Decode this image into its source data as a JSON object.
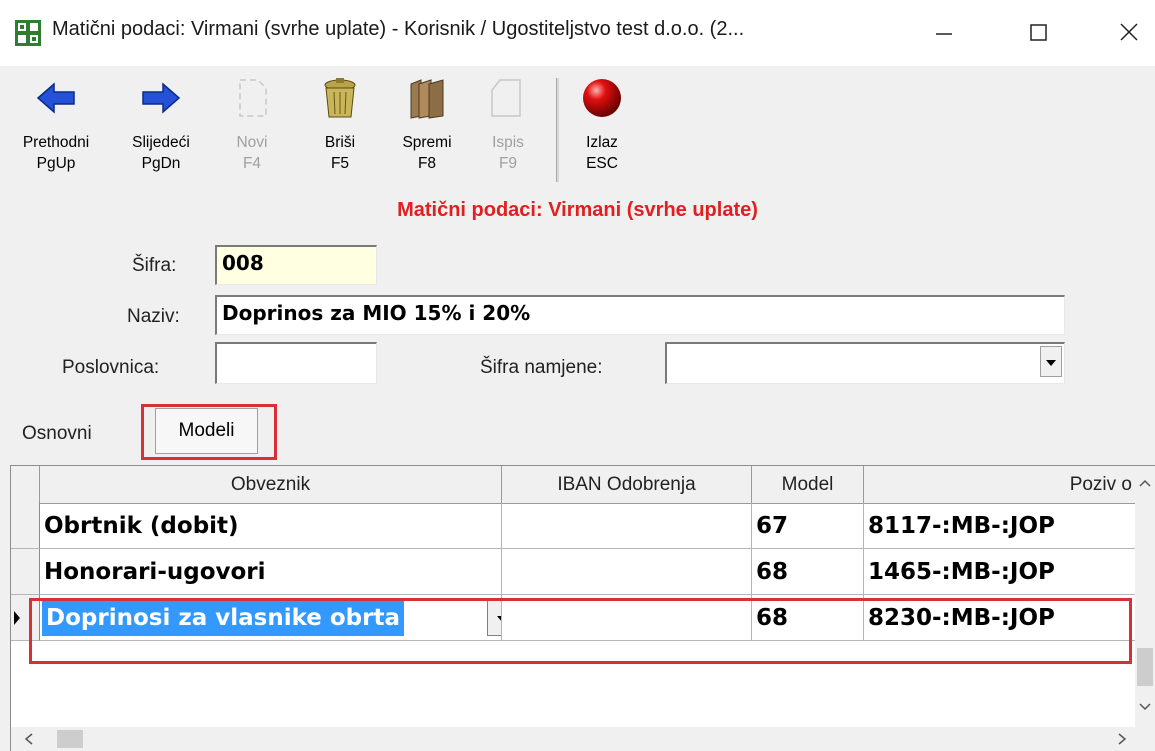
{
  "window": {
    "title": "Matični podaci: Virmani (svrhe uplate) - Korisnik / Ugostiteljstvo test d.o.o. (2..."
  },
  "toolbar": {
    "buttons": [
      {
        "label": "Prethodni\nPgUp",
        "icon": "arrow-left-icon",
        "enabled": true
      },
      {
        "label": "Slijedeći\nPgDn",
        "icon": "arrow-right-icon",
        "enabled": true
      },
      {
        "label": "Novi\nF4",
        "icon": "new-document-icon",
        "enabled": false
      },
      {
        "label": "Briši\nF5",
        "icon": "trash-bin-icon",
        "enabled": true
      },
      {
        "label": "Spremi\nF8",
        "icon": "folders-save-icon",
        "enabled": true
      },
      {
        "label": "Ispis\nF9",
        "icon": "print-icon",
        "enabled": false
      },
      {
        "label": "Izlaz\nESC",
        "icon": "exit-red-ball-icon",
        "enabled": true
      }
    ]
  },
  "page": {
    "heading": "Matični podaci: Virmani (svrhe uplate)"
  },
  "form": {
    "sifra_label": "Šifra:",
    "sifra_value": "008",
    "naziv_label": "Naziv:",
    "naziv_value": "Doprinos za MIO 15% i 20%",
    "poslovnica_label": "Poslovnica:",
    "poslovnica_value": "",
    "sifra_namjene_label": "Šifra namjene:",
    "sifra_namjene_value": ""
  },
  "tabs": [
    {
      "label": "Osnovni",
      "active": false
    },
    {
      "label": "Modeli",
      "active": true
    }
  ],
  "grid": {
    "columns": [
      "Obveznik",
      "IBAN Odobrenja",
      "Model",
      "Poziv o"
    ],
    "rows": [
      {
        "obveznik": "Obrtnik (dobit)",
        "iban": "",
        "model": "67",
        "poziv": "8117-:MB-:JOP",
        "selected": false
      },
      {
        "obveznik": "Honorari-ugovori",
        "iban": "",
        "model": "68",
        "poziv": "1465-:MB-:JOP",
        "selected": false
      },
      {
        "obveznik": "Doprinosi za vlasnike obrta",
        "iban": "",
        "model": "68",
        "poziv": "8230-:MB-:JOP",
        "selected": true
      }
    ]
  },
  "colors": {
    "heading": "#e02020",
    "highlight_box": "#d83036",
    "selection": "#3399ff",
    "code_field_bg": "#ffffe1"
  }
}
